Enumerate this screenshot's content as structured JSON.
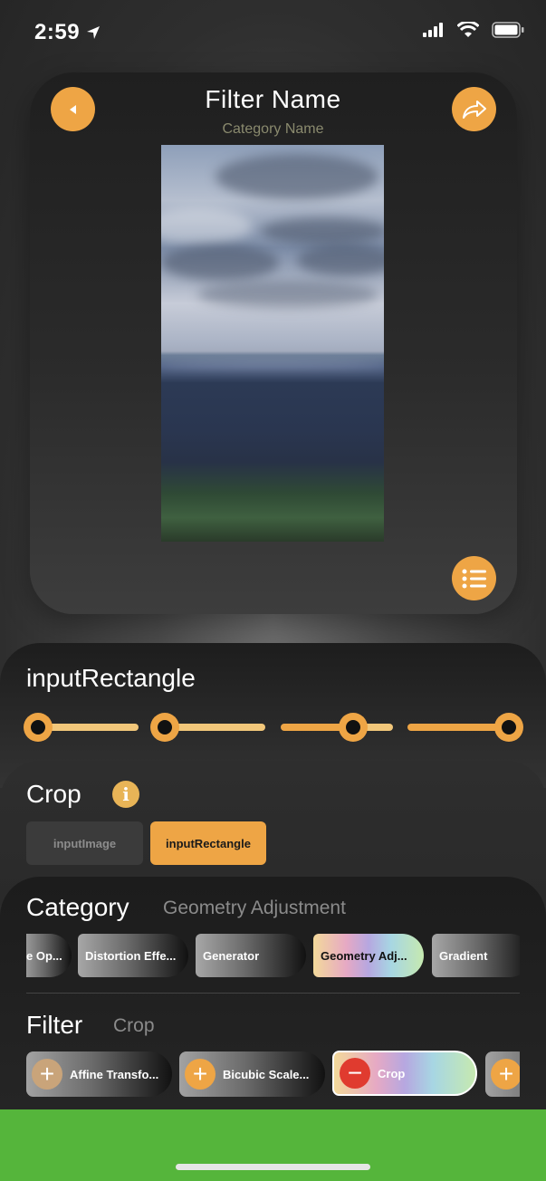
{
  "status_bar": {
    "time": "2:59"
  },
  "header": {
    "title": "Filter Name",
    "subtitle": "Category Name"
  },
  "icons": {
    "back": "back-arrow-icon",
    "share": "share-icon",
    "list": "list-icon",
    "info": "info-icon",
    "location": "location-arrow-icon",
    "signal": "cellular-signal-icon",
    "wifi": "wifi-icon",
    "battery": "battery-icon"
  },
  "colors": {
    "accent": "#eea545",
    "accent_light": "#f2c77a",
    "bottom_bar": "#55b53b"
  },
  "parameter": {
    "name": "inputRectangle",
    "slider_positions": [
      0.0,
      0.0,
      0.6,
      1.0
    ]
  },
  "filter_info": {
    "name": "Crop",
    "inputs": [
      {
        "label": "inputImage",
        "selected": false
      },
      {
        "label": "inputRectangle",
        "selected": true
      }
    ]
  },
  "category": {
    "label": "Category",
    "selected": "Geometry Adjustment",
    "items": [
      "e Op...",
      "Distortion Effe...",
      "Generator",
      "Geometry Adj...",
      "Gradient"
    ]
  },
  "filter": {
    "label": "Filter",
    "selected": "Crop",
    "items": [
      {
        "label": "Affine Transfo...",
        "action": "+"
      },
      {
        "label": "Bicubic Scale...",
        "action": "+"
      },
      {
        "label": "Crop",
        "action": "−"
      },
      {
        "label": "",
        "action": "+"
      }
    ]
  }
}
